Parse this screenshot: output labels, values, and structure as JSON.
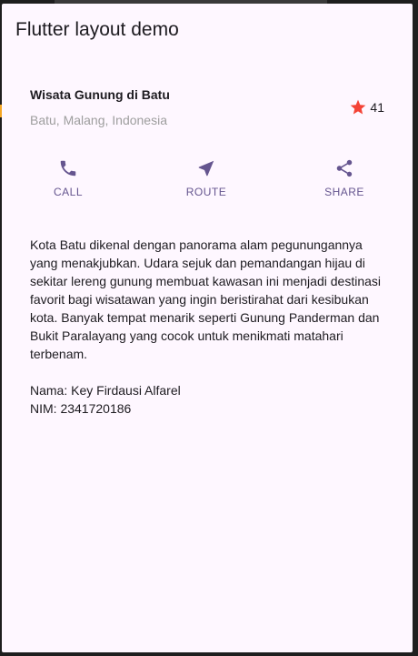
{
  "app": {
    "title": "Flutter layout demo"
  },
  "title_section": {
    "name": "Wisata Gunung di Batu",
    "location": "Batu, Malang, Indonesia",
    "rating_count": "41",
    "star_icon": "star-icon",
    "star_color": "#f44336"
  },
  "buttons": [
    {
      "label": "CALL",
      "icon": "phone-icon"
    },
    {
      "label": "ROUTE",
      "icon": "near-me-icon"
    },
    {
      "label": "SHARE",
      "icon": "share-icon"
    }
  ],
  "text_section": {
    "description": "Kota Batu dikenal dengan panorama alam pegunungannya yang menakjubkan. Udara sejuk dan pemandangan hijau di sekitar lereng gunung membuat kawasan ini menjadi destinasi favorit bagi wisatawan yang ingin beristirahat dari kesibukan kota. Banyak tempat menarik seperti Gunung Panderman dan Bukit Paralayang yang cocok untuk menikmati matahari terbenam.",
    "student_name": "Nama: Key Firdausi Alfarel",
    "student_nim": "NIM: 2341720186"
  },
  "colors": {
    "background": "#fef7ff",
    "accent": "#65558f",
    "star": "#f44336",
    "muted_text": "#9e9e9e"
  }
}
